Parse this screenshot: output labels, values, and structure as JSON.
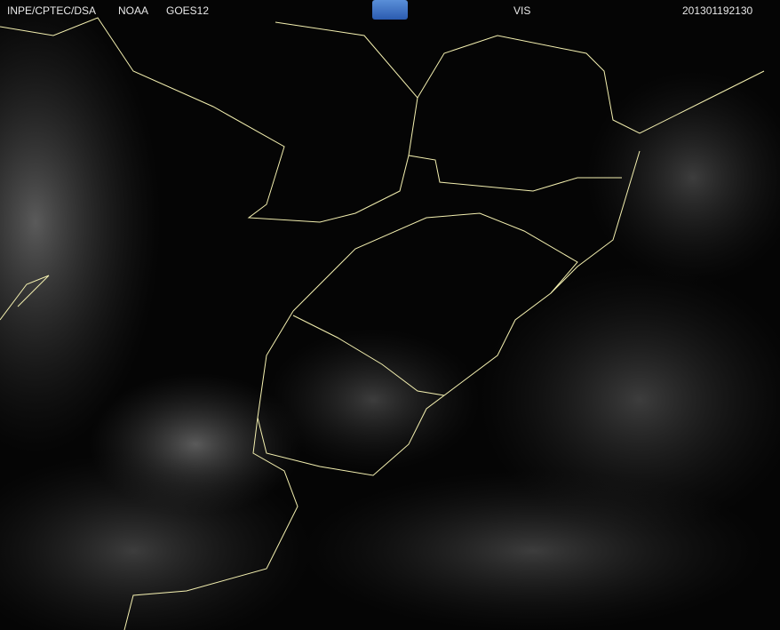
{
  "header": {
    "agency": "INPE/CPTEC/DSA",
    "source": "NOAA",
    "satellite": "GOES12",
    "channel": "VIS",
    "timestamp": "201301192130"
  },
  "logo": "CPTEC",
  "colors": {
    "border": "#f4f0b0",
    "background": "#050505"
  }
}
